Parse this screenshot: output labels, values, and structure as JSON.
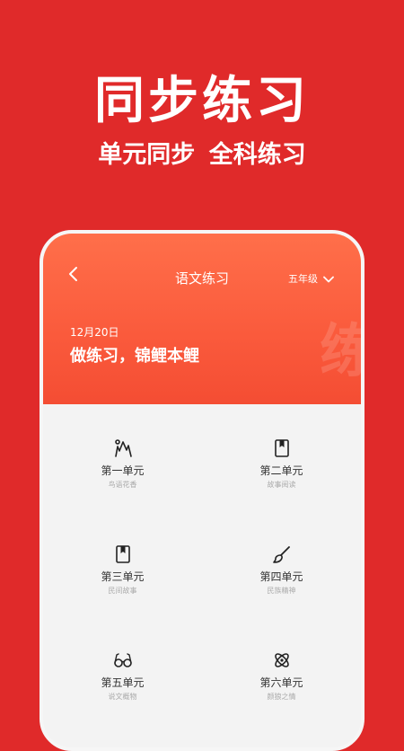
{
  "promo": {
    "title": "同步练习",
    "subtitle": "单元同步  全科练习"
  },
  "header": {
    "title": "语文练习",
    "grade": "五年级",
    "date": "12月20日",
    "slogan": "做练习，锦鲤本鲤",
    "watermark": "练"
  },
  "units": [
    {
      "name": "第一单元",
      "desc": "鸟语花香",
      "icon": "person-mountain-icon"
    },
    {
      "name": "第二单元",
      "desc": "故事阅读",
      "icon": "book-icon"
    },
    {
      "name": "第三单元",
      "desc": "民间故事",
      "icon": "book-icon"
    },
    {
      "name": "第四单元",
      "desc": "民族精神",
      "icon": "brush-icon"
    },
    {
      "name": "第五单元",
      "desc": "说文概物",
      "icon": "glasses-icon"
    },
    {
      "name": "第六单元",
      "desc": "颜狼之情",
      "icon": "atom-icon"
    }
  ],
  "colors": {
    "background": "#e02a2a",
    "header_gradient_start": "#ff6f4a",
    "header_gradient_end": "#f44d33"
  }
}
